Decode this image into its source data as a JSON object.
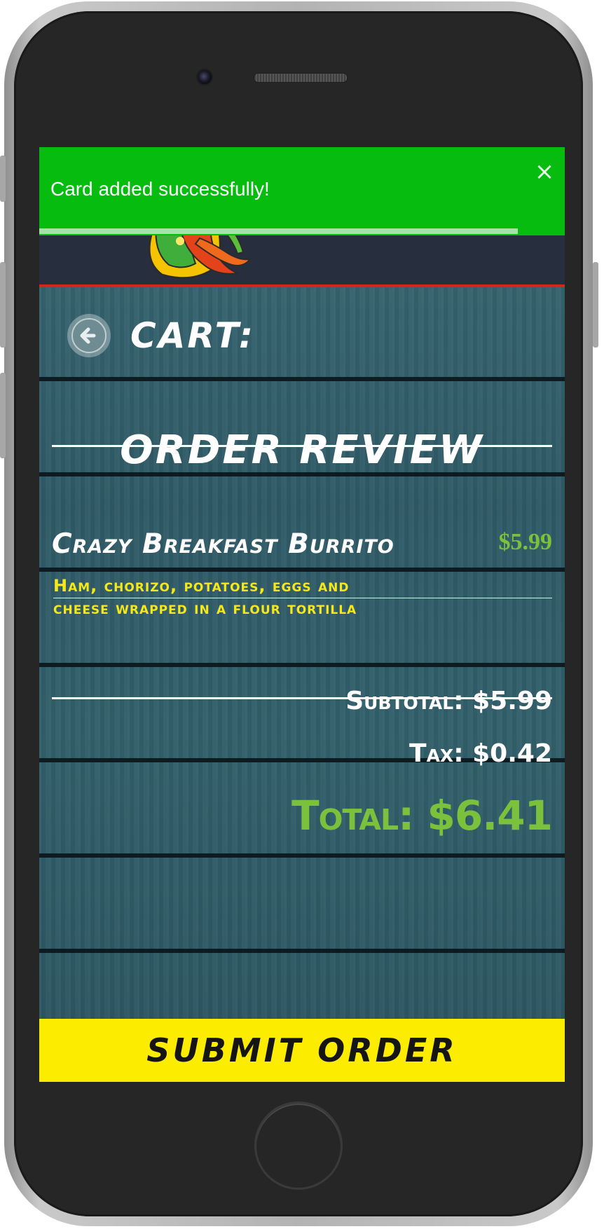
{
  "toast": {
    "message": "Card added successfully!",
    "close_glyph": "×",
    "progress": 0.91,
    "color": "#06bd0f"
  },
  "header": {
    "logo_icon": "taco-logo-icon",
    "accent_color": "#d4271b"
  },
  "cart": {
    "title": "Cart:",
    "back_icon": "back-arrow-icon"
  },
  "order_review": {
    "title": "Order Review"
  },
  "items": [
    {
      "name": "Crazy Breakfast Burrito",
      "price": "$5.99",
      "description": "Ham, chorizo, potatoes, eggs and cheese wrapped in a flour tortilla"
    }
  ],
  "summary": {
    "subtotal": "Subtotal: $5.99",
    "tax": "Tax: $0.42",
    "total": "Total: $6.41"
  },
  "actions": {
    "submit_label": "Submit Order"
  },
  "colors": {
    "price_green": "#7bc13b",
    "description_yellow": "#f4e81a",
    "submit_yellow": "#fced00"
  }
}
